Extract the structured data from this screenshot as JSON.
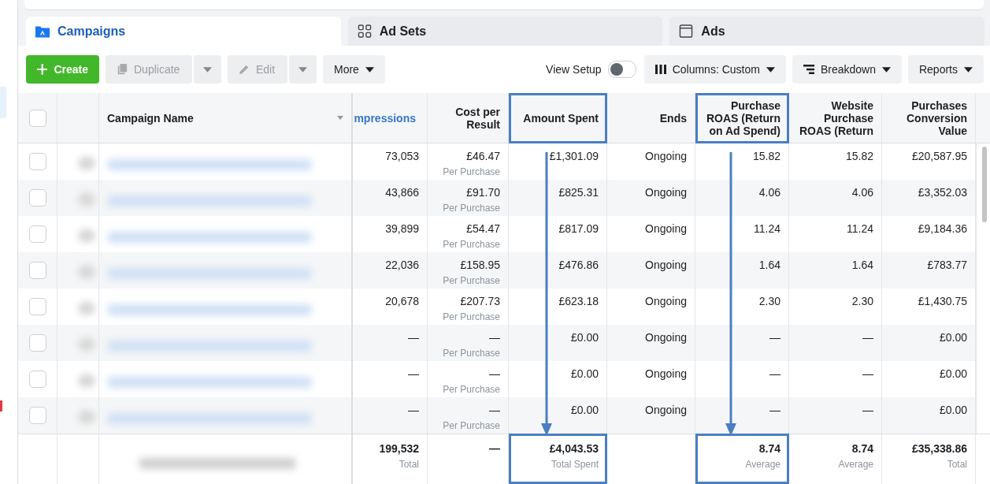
{
  "tabs": [
    {
      "label": "Campaigns",
      "kind": "folder",
      "selected": true
    },
    {
      "label": "Ad Sets",
      "kind": "grid",
      "selected": false
    },
    {
      "label": "Ads",
      "kind": "window",
      "selected": false
    }
  ],
  "toolbar": {
    "left": [
      {
        "label": "Create",
        "kind": "create",
        "disabled": false,
        "split": false
      },
      {
        "label": "Duplicate",
        "kind": "duplicate",
        "disabled": true,
        "split": true
      },
      {
        "label": "Edit",
        "kind": "edit",
        "disabled": true,
        "split": true
      },
      {
        "label": "More",
        "kind": "menu",
        "disabled": false,
        "split": false
      }
    ],
    "view_setup": {
      "label": "View Setup",
      "on": false
    },
    "right": [
      {
        "label": "Columns: Custom",
        "kind": "columns"
      },
      {
        "label": "Breakdown",
        "kind": "breakdown"
      },
      {
        "label": "Reports",
        "kind": "menu"
      }
    ]
  },
  "table": {
    "select_all": {
      "checked": false
    },
    "name_header": {
      "lines": [
        "Campaign Name"
      ]
    },
    "columns": [
      {
        "lines": [
          "mpressions"
        ],
        "sorted": true,
        "highlighted": false
      },
      {
        "lines": [
          "Cost per",
          "Result"
        ],
        "sorted": false,
        "highlighted": false
      },
      {
        "lines": [
          "Amount Spent"
        ],
        "sorted": false,
        "highlighted": true
      },
      {
        "lines": [
          "Ends"
        ],
        "sorted": false,
        "highlighted": false,
        "no_total": true
      },
      {
        "lines": [
          "Purchase",
          "ROAS (Return",
          "on Ad Spend)"
        ],
        "sorted": false,
        "highlighted": true
      },
      {
        "lines": [
          "Website",
          "Purchase",
          "ROAS (Return"
        ],
        "sorted": false,
        "highlighted": false
      },
      {
        "lines": [
          "Purchases",
          "Conversion",
          "Value"
        ],
        "sorted": false,
        "highlighted": false
      }
    ],
    "rows": [
      {
        "checked": false,
        "cells": [
          {
            "value": "73,053"
          },
          {
            "value": "£46.47",
            "note": "Per Purchase"
          },
          {
            "value": "£1,301.09"
          },
          {
            "value": "Ongoing"
          },
          {
            "value": "15.82"
          },
          {
            "value": "15.82"
          },
          {
            "value": "£20,587.95"
          }
        ]
      },
      {
        "checked": false,
        "cells": [
          {
            "value": "43,866"
          },
          {
            "value": "£91.70",
            "note": "Per Purchase"
          },
          {
            "value": "£825.31"
          },
          {
            "value": "Ongoing"
          },
          {
            "value": "4.06"
          },
          {
            "value": "4.06"
          },
          {
            "value": "£3,352.03"
          }
        ]
      },
      {
        "checked": false,
        "cells": [
          {
            "value": "39,899"
          },
          {
            "value": "£54.47",
            "note": "Per Purchase"
          },
          {
            "value": "£817.09"
          },
          {
            "value": "Ongoing"
          },
          {
            "value": "11.24"
          },
          {
            "value": "11.24"
          },
          {
            "value": "£9,184.36"
          }
        ]
      },
      {
        "checked": false,
        "cells": [
          {
            "value": "22,036"
          },
          {
            "value": "£158.95",
            "note": "Per Purchase"
          },
          {
            "value": "£476.86"
          },
          {
            "value": "Ongoing"
          },
          {
            "value": "1.64"
          },
          {
            "value": "1.64"
          },
          {
            "value": "£783.77"
          }
        ]
      },
      {
        "checked": false,
        "cells": [
          {
            "value": "20,678"
          },
          {
            "value": "£207.73",
            "note": "Per Purchase"
          },
          {
            "value": "£623.18"
          },
          {
            "value": "Ongoing"
          },
          {
            "value": "2.30"
          },
          {
            "value": "2.30"
          },
          {
            "value": "£1,430.75"
          }
        ]
      },
      {
        "checked": false,
        "cells": [
          {
            "value": "—"
          },
          {
            "value": "—",
            "note": "Per Purchase"
          },
          {
            "value": "£0.00"
          },
          {
            "value": "Ongoing"
          },
          {
            "value": "—"
          },
          {
            "value": "—"
          },
          {
            "value": "£0.00"
          }
        ]
      },
      {
        "checked": false,
        "cells": [
          {
            "value": "—"
          },
          {
            "value": "—",
            "note": "Per Purchase"
          },
          {
            "value": "£0.00"
          },
          {
            "value": "Ongoing"
          },
          {
            "value": "—"
          },
          {
            "value": "—"
          },
          {
            "value": "£0.00"
          }
        ]
      },
      {
        "checked": false,
        "cells": [
          {
            "value": "—"
          },
          {
            "value": "—",
            "note": "Per Purchase"
          },
          {
            "value": "£0.00"
          },
          {
            "value": "Ongoing"
          },
          {
            "value": "—"
          },
          {
            "value": "—"
          },
          {
            "value": "£0.00"
          }
        ]
      }
    ],
    "totals": [
      {
        "value": "199,532",
        "note": "Total"
      },
      {
        "value": "—"
      },
      {
        "value": "£4,043.53",
        "note": "Total Spent"
      },
      {
        "value": "8.74",
        "note": "Average"
      },
      {
        "value": "8.74",
        "note": "Average"
      },
      {
        "value": "£35,338.86",
        "note": "Total"
      }
    ]
  }
}
